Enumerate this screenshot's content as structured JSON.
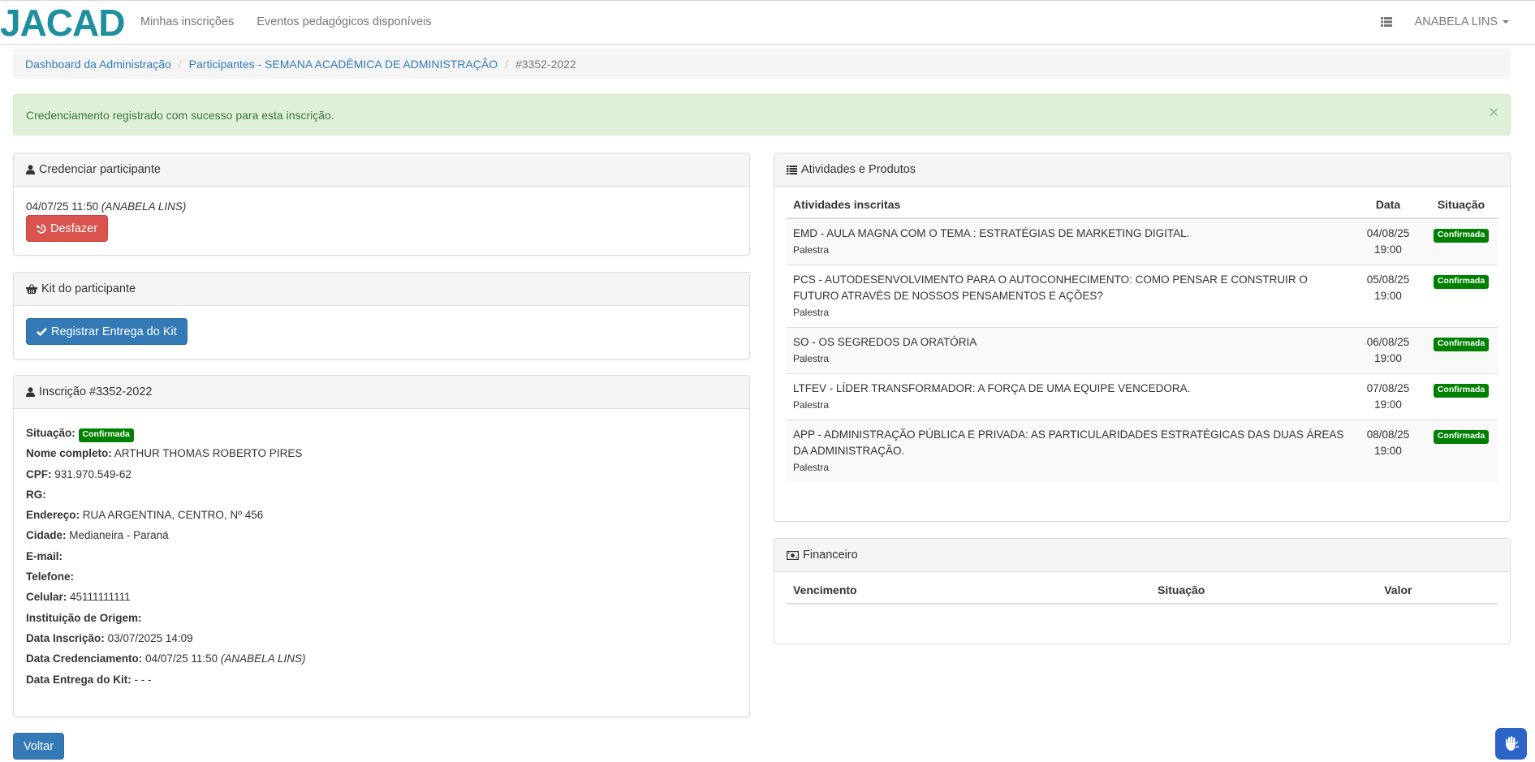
{
  "brand": {
    "logo_text": "JACAD"
  },
  "nav": {
    "links": [
      "Minhas inscrições",
      "Eventos pedagógicos disponíveis"
    ],
    "user": "ANABELA LINS"
  },
  "breadcrumb": {
    "items": [
      "Dashboard da Administração",
      "Participantes - SEMANA ACADÊMICA DE ADMINISTRAÇÃO"
    ],
    "active": "#3352-2022"
  },
  "alert": {
    "message": "Credenciamento registrado com sucesso para esta inscrição.",
    "close": "×"
  },
  "credenciar": {
    "title": "Credenciar participante",
    "timestamp": "04/07/25 11:50",
    "by": "(ANABELA LINS)",
    "undo_label": "Desfazer"
  },
  "kit": {
    "title": "Kit do participante",
    "button_label": "Registrar Entrega do Kit"
  },
  "inscricao": {
    "title": "Inscrição #3352-2022",
    "situacao_label": "Situação:",
    "situacao_badge": "Confirmada",
    "fields": [
      {
        "label": "Nome completo:",
        "value": "ARTHUR THOMAS ROBERTO PIRES"
      },
      {
        "label": "CPF:",
        "value": "931.970.549-62"
      },
      {
        "label": "RG:",
        "value": ""
      },
      {
        "label": "Endereço:",
        "value": "RUA ARGENTINA, CENTRO, Nº 456"
      },
      {
        "label": "Cidade:",
        "value": "Medianeira - Paraná"
      },
      {
        "label": "E-mail:",
        "value": ""
      },
      {
        "label": "Telefone:",
        "value": ""
      },
      {
        "label": "Celular:",
        "value": "45111111111"
      },
      {
        "label": "Instituição de Origem:",
        "value": ""
      },
      {
        "label": "Data Inscrição:",
        "value": "03/07/2025 14:09"
      }
    ],
    "credenciamento_label": "Data Credenciamento:",
    "credenciamento_value": "04/07/25 11:50",
    "credenciamento_by": "(ANABELA LINS)",
    "kit_label": "Data Entrega do Kit:",
    "kit_value": "- - -"
  },
  "atividades": {
    "title": "Atividades e Produtos",
    "headers": {
      "atividade": "Atividades inscritas",
      "data": "Data",
      "situacao": "Situação"
    },
    "rows": [
      {
        "name": "EMD - AULA MAGNA COM O TEMA : ESTRATÉGIAS DE MARKETING DIGITAL.",
        "type": "Palestra",
        "date": "04/08/25",
        "time": "19:00",
        "status": "Confirmada"
      },
      {
        "name": "PCS - AUTODESENVOLVIMENTO PARA O AUTOCONHECIMENTO: COMO PENSAR E CONSTRUIR O FUTURO ATRAVÉS DE NOSSOS PENSAMENTOS E AÇÕES?",
        "type": "Palestra",
        "date": "05/08/25",
        "time": "19:00",
        "status": "Confirmada"
      },
      {
        "name": "SO - OS SEGREDOS DA ORATÓRIA",
        "type": "Palestra",
        "date": "06/08/25",
        "time": "19:00",
        "status": "Confirmada"
      },
      {
        "name": "LTFEV - LÍDER TRANSFORMADOR: A FORÇA DE UMA EQUIPE VENCEDORA.",
        "type": "Palestra",
        "date": "07/08/25",
        "time": "19:00",
        "status": "Confirmada"
      },
      {
        "name": "APP - ADMINISTRAÇÃO PÚBLICA E PRIVADA: AS PARTICULARIDADES ESTRATÉGICAS DAS DUAS ÁREAS DA ADMINISTRAÇÃO.",
        "type": "Palestra",
        "date": "08/08/25",
        "time": "19:00",
        "status": "Confirmada"
      }
    ]
  },
  "financeiro": {
    "title": "Financeiro",
    "headers": {
      "vencimento": "Vencimento",
      "situacao": "Situação",
      "valor": "Valor"
    }
  },
  "footer": {
    "back_label": "Voltar"
  },
  "colors": {
    "primary": "#337ab7",
    "danger": "#d9534f",
    "success_badge": "#008000",
    "alert_bg": "#dff0d8",
    "brand": "#1d8f9d"
  },
  "icons": [
    "list-icon",
    "user-icon",
    "undo-icon",
    "basket-icon",
    "check-icon",
    "list-ul-icon",
    "money-icon",
    "accessibility-hand-icon"
  ]
}
